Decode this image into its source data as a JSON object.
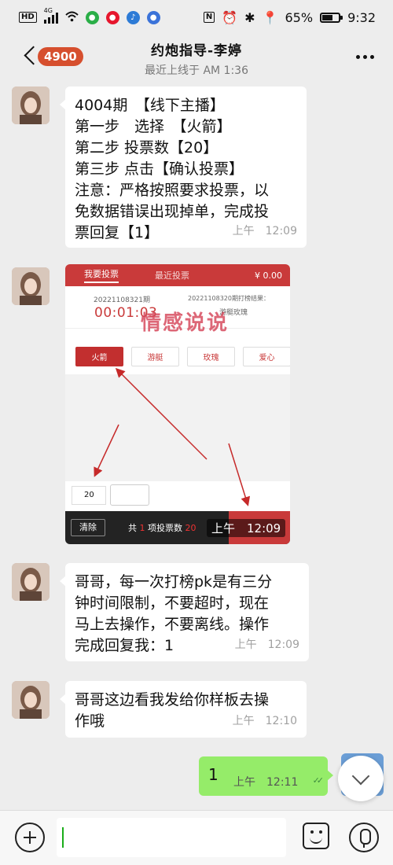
{
  "status_bar": {
    "hd_label": "HD",
    "network_label": "4G",
    "battery_percent": "65%",
    "clock": "9:32",
    "icons": [
      "wechat-icon",
      "weibo-icon",
      "music-icon",
      "browser-icon",
      "nfc-icon",
      "alarm-icon",
      "bluetooth-icon",
      "location-icon",
      "battery-icon"
    ]
  },
  "header": {
    "unread_count": "4900",
    "title": "约炮指导-李婷",
    "subtitle": "最近上线于 AM 1:36"
  },
  "messages": [
    {
      "sender": "other",
      "text": "4004期　【线下主播】\n第一步　选择　【火箭】\n第二步 投票数【20】\n第三步 点击【确认投票】\n注意：严格按照要求投票，以\n免数据错误出现掉单，完成投\n票回复【1】",
      "time": "上午　12:09"
    },
    {
      "sender": "other",
      "type": "image",
      "screenshot": {
        "tab_active": "我要投票",
        "tab_recent": "最近投票",
        "balance": "¥ 0.00",
        "issue_no": "20221108321期",
        "countdown": "00:01:03",
        "last_result": "20221108320期打榜结果：",
        "last_result_value": "游艇玫瑰",
        "watermark": "情感说说",
        "options": [
          "火箭",
          "游艇",
          "玫瑰",
          "爱心"
        ],
        "vote_count": "20",
        "clear_label": "清除",
        "total_prefix": "共",
        "total_items": "1",
        "total_middle": "项投票数",
        "total_votes": "20",
        "time_overlay": "上午　12:09"
      }
    },
    {
      "sender": "other",
      "text": "哥哥，每一次打榜pk是有三分\n钟时间限制，不要超时，现在\n马上去操作，不要离线。操作\n完成回复我：1",
      "time": "上午　12:09"
    },
    {
      "sender": "other",
      "text": "哥哥这边看我发给你样板去操\n作哦",
      "time": "上午　12:10"
    },
    {
      "sender": "self",
      "text": "1",
      "time": "上午　12:11"
    }
  ],
  "input_bar": {
    "message_value": ""
  },
  "colors": {
    "background": "#ededed",
    "outgoing_bubble": "#95ec69",
    "badge": "#d64f2e",
    "screenshot_red": "#c93a3a"
  }
}
